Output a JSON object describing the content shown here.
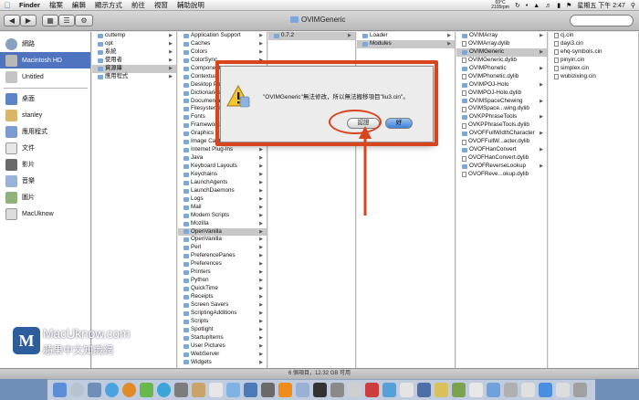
{
  "menubar": {
    "items": [
      "Finder",
      "檔案",
      "編輯",
      "顯示方式",
      "前往",
      "視窗",
      "輔助說明"
    ],
    "temp_top": "69°C",
    "temp_bottom": "2105rpm",
    "clock": "星期五 下午 2:47"
  },
  "window": {
    "title": "OVIMGeneric",
    "status": "6 個項目，12.32 GB 可用"
  },
  "sidebar": {
    "items": [
      "網路",
      "Macintosh HD",
      "Untitled",
      "桌面",
      "stanley",
      "應用程式",
      "文件",
      "影片",
      "音樂",
      "圖片",
      "MacUknow"
    ]
  },
  "columns": {
    "col1": [
      "cuttemp",
      "opt",
      "系統",
      "使用者",
      "資源庫",
      "應用程式"
    ],
    "col2": [
      "Application Support",
      "Caches",
      "Colors",
      "ColorSync",
      "Components",
      "Contextual Menu Items",
      "Desktop Pictures",
      "Dictionaries",
      "Documentation",
      "Filesystems",
      "Fonts",
      "Frameworks",
      "Graphics",
      "Image Capture",
      "Internet Plug-Ins",
      "Java",
      "Keyboard Layouts",
      "Keychains",
      "LaunchAgents",
      "LaunchDaemons",
      "Logs",
      "Mail",
      "Modem Scripts",
      "Mozilla",
      "OpenVanilla",
      "OpenVanilla",
      "Perl",
      "PreferencePanes",
      "Preferences",
      "Printers",
      "Python",
      "QuickTime",
      "Receipts",
      "Screen Savers",
      "ScriptingAdditions",
      "Scripts",
      "Spotlight",
      "StartupItems",
      "User Pictures",
      "WebServer",
      "Widgets"
    ],
    "col3": [
      "0.7.2"
    ],
    "col4": [
      "Loader",
      "Modules"
    ],
    "col5": [
      "OVIMArray",
      "OVIMArray.dylib",
      "OVIMGeneric",
      "OVIMGeneric.dylib",
      "OVIMPhonetic",
      "OVIMPhonetic.dylib",
      "OVIMPOJ-Holo",
      "OVIMPOJ-Holo.dylib",
      "OVIMSpaceChewing",
      "OVIMSpace...wing.dylib",
      "OVKPPhraseTools",
      "OVKPPhraseTools.dylib",
      "OVOFFullWidthCharacter",
      "OVOFFullW...acter.dylib",
      "OVOFHanConvert",
      "OVOFHanConvert.dylib",
      "OVOFReverseLookup",
      "OVOFReve...okup.dylib"
    ],
    "col6": [
      "cj.cin",
      "dayi3.cin",
      "ehq-symbols.cin",
      "pinyin.cin",
      "simplex.cin",
      "wubizixing.cin"
    ]
  },
  "dialog": {
    "message": "\"OVIMGeneric\"無法修改，所以無法搬移項目\"liu3.cin\"。",
    "cancel_label": "認證",
    "ok_label": "好"
  },
  "watermark": {
    "line1": "MacUknow.com",
    "line2": "蘋果中文知識網",
    "logo_letter": "M"
  },
  "colors": {
    "selection": "#4f74bf",
    "annotation": "#d9441c",
    "ok_button": "#3c80d8"
  }
}
